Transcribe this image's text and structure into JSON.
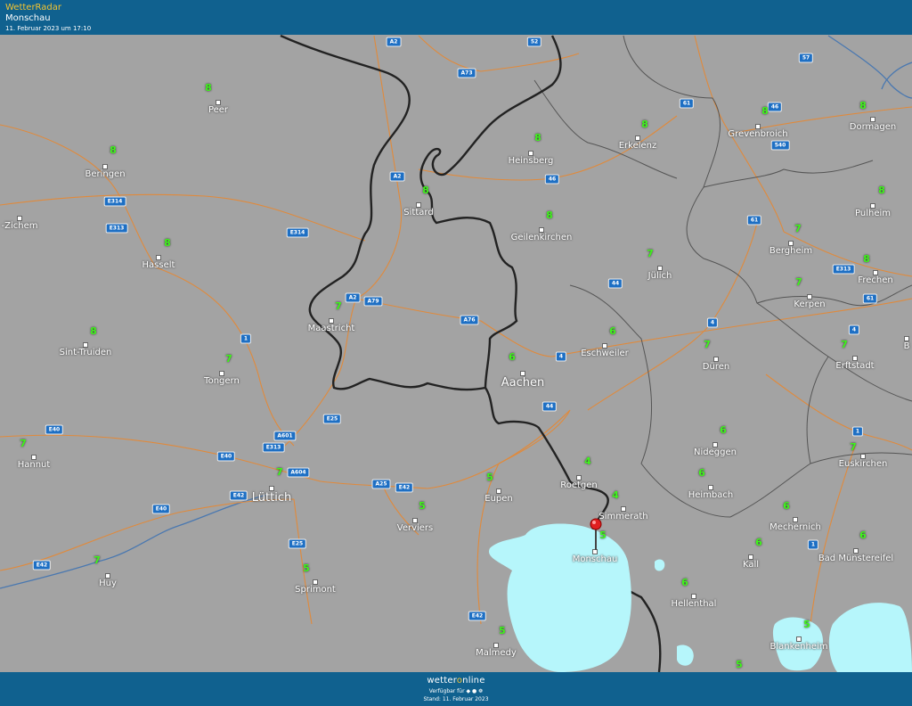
{
  "header": {
    "brand": "WetterRadar",
    "location": "Monschau",
    "timestamp": "11. Februar 2023 um 17:10"
  },
  "footer": {
    "logo_a": "wetter",
    "logo_o": "o",
    "logo_b": "nline",
    "availability": "Verfügbar für",
    "stand": "Stand: 11. Februar 2023"
  },
  "colors": {
    "header": "#10618f",
    "map_background": "#a3a3a3",
    "border": "#222222",
    "roads": "#e08a3c",
    "rivers": "#4a78b0",
    "radar_precip": "#b6f6fb",
    "values": "#3ef51a",
    "marker": "#e02020"
  },
  "cities": [
    {
      "name": "Peer",
      "value": "8"
    },
    {
      "name": "Beringen",
      "value": "8"
    },
    {
      "name": "-Zichem",
      "value": ""
    },
    {
      "name": "Hasselt",
      "value": "8"
    },
    {
      "name": "Sint-Truiden",
      "value": "8"
    },
    {
      "name": "Tongern",
      "value": "7"
    },
    {
      "name": "Hannut",
      "value": "7"
    },
    {
      "name": "Huy",
      "value": "7"
    },
    {
      "name": "Lüttich",
      "value": "7"
    },
    {
      "name": "Sprimont",
      "value": "5"
    },
    {
      "name": "Maastricht",
      "value": "7"
    },
    {
      "name": "Sittard",
      "value": "8"
    },
    {
      "name": "Heinsberg",
      "value": "8"
    },
    {
      "name": "Erkelenz",
      "value": "8"
    },
    {
      "name": "Grevenbroich",
      "value": "8"
    },
    {
      "name": "Dormagen",
      "value": "8"
    },
    {
      "name": "Geilenkirchen",
      "value": "8"
    },
    {
      "name": "Pulheim",
      "value": "8"
    },
    {
      "name": "Bergheim",
      "value": "7"
    },
    {
      "name": "Jülich",
      "value": "7"
    },
    {
      "name": "Frechen",
      "value": "8"
    },
    {
      "name": "Kerpen",
      "value": "7"
    },
    {
      "name": "Aachen",
      "value": "6"
    },
    {
      "name": "Eschweiler",
      "value": "6"
    },
    {
      "name": "Düren",
      "value": "7"
    },
    {
      "name": "Erftstadt",
      "value": "7"
    },
    {
      "name": "Nideggen",
      "value": "6"
    },
    {
      "name": "Euskirchen",
      "value": "7"
    },
    {
      "name": "Roetgen",
      "value": "4"
    },
    {
      "name": "Heimbach",
      "value": "6"
    },
    {
      "name": "Simmerath",
      "value": "4"
    },
    {
      "name": "Eupen",
      "value": "5"
    },
    {
      "name": "Verviers",
      "value": "5"
    },
    {
      "name": "Monschau",
      "value": "5"
    },
    {
      "name": "Mechernich",
      "value": "6"
    },
    {
      "name": "Kall",
      "value": "6"
    },
    {
      "name": "Bad Münstereifel",
      "value": "6"
    },
    {
      "name": "Hellenthal",
      "value": "6"
    },
    {
      "name": "Blankenheim",
      "value": "5"
    },
    {
      "name": "Malmedy",
      "value": "5"
    },
    {
      "name": "B",
      "value": ""
    }
  ],
  "roads": [
    "A2",
    "52",
    "A73",
    "61",
    "46",
    "57",
    "540",
    "A2",
    "E314",
    "E313",
    "E314",
    "46",
    "61",
    "A2",
    "A79",
    "A76",
    "44",
    "4",
    "4",
    "61",
    "1",
    "E313",
    "4",
    "44",
    "1",
    "E25",
    "E40",
    "A601",
    "E313",
    "E40",
    "A25",
    "A604",
    "E42",
    "E40",
    "E42",
    "E42",
    "E25",
    "E42",
    "1"
  ],
  "extra_values": [
    "5"
  ]
}
